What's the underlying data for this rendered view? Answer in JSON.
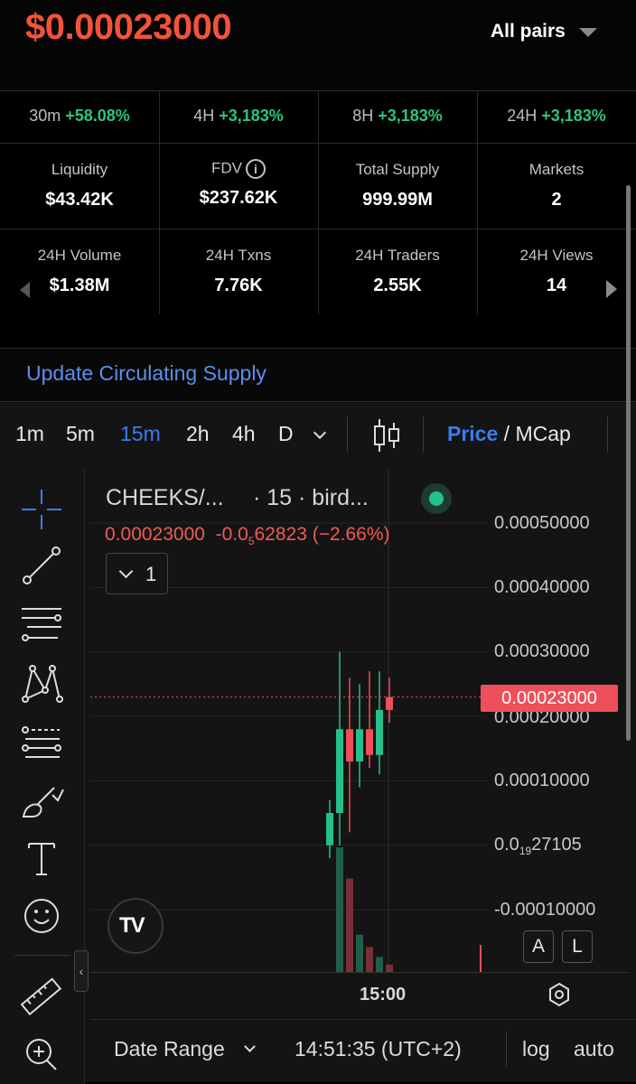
{
  "header": {
    "price": "$0.00023000",
    "pairs_label": "All pairs"
  },
  "changes": [
    {
      "period": "30m",
      "value": "+58.08%"
    },
    {
      "period": "4H",
      "value": "+3,183%"
    },
    {
      "period": "8H",
      "value": "+3,183%"
    },
    {
      "period": "24H",
      "value": "+3,183%"
    }
  ],
  "stats_row1": [
    {
      "label": "Liquidity",
      "value": "$43.42K"
    },
    {
      "label": "FDV",
      "value": "$237.62K",
      "icon": "info-icon",
      "icon_glyph": "i"
    },
    {
      "label": "Total Supply",
      "value": "999.99M"
    },
    {
      "label": "Markets",
      "value": "2"
    }
  ],
  "stats_row2": [
    {
      "label": "24H Volume",
      "value": "$1.38M"
    },
    {
      "label": "24H Txns",
      "value": "7.76K"
    },
    {
      "label": "24H Traders",
      "value": "2.55K"
    },
    {
      "label": "24H Views",
      "value": "14"
    }
  ],
  "update_link": "Update Circulating Supply",
  "timeframes": [
    "1m",
    "5m",
    "15m",
    "2h",
    "4h",
    "D"
  ],
  "active_timeframe": "15m",
  "price_mode": {
    "active": "Price",
    "separator": "/",
    "other": "MCap"
  },
  "chart": {
    "symbol": "CHEEKS/...",
    "symbol_rest": "· 15 · bird...",
    "ohlc_price": "0.00023000",
    "ohlc_change_pre": "-0.0",
    "ohlc_change_sub": "5",
    "ohlc_change_post": "62823 (−2.66%)",
    "indicator_count": "1",
    "last_price_tag": "0.00023000",
    "axis_labels": {
      "l1": "0.00050000",
      "l2": "0.00040000",
      "l3": "0.00030000",
      "l4": "0.00020000",
      "l5": "0.00010000",
      "l6_pre": "0.0",
      "l6_sub": "19",
      "l6_post": "27105",
      "l7": "-0.00010000"
    },
    "time_label": "15:00",
    "scale_buttons": [
      "A",
      "L"
    ],
    "logo_text": "TV"
  },
  "chart_data": {
    "type": "candlestick",
    "symbol": "CHEEKS/...",
    "interval": "15",
    "ylim": [
      -0.0001,
      0.0005
    ],
    "x_tick": "15:00",
    "candles": [
      {
        "open": 0.0,
        "high": 7e-05,
        "low": -2e-05,
        "close": 5e-05,
        "color": "up"
      },
      {
        "open": 5e-05,
        "high": 0.0003,
        "low": 0.0,
        "close": 0.00018,
        "color": "up"
      },
      {
        "open": 0.00018,
        "high": 0.00026,
        "low": 2e-05,
        "close": 0.00013,
        "color": "down"
      },
      {
        "open": 0.00013,
        "high": 0.00025,
        "low": 9e-05,
        "close": 0.00018,
        "color": "up"
      },
      {
        "open": 0.00018,
        "high": 0.00027,
        "low": 0.00012,
        "close": 0.00014,
        "color": "down"
      },
      {
        "open": 0.00014,
        "high": 0.00027,
        "low": 0.00011,
        "close": 0.00021,
        "color": "up"
      },
      {
        "open": 0.00021,
        "high": 0.00026,
        "low": 0.00019,
        "close": 0.00023,
        "color": "down"
      }
    ],
    "volume": [
      0.0,
      1.0,
      0.75,
      0.3,
      0.2,
      0.12,
      0.06
    ],
    "last_price": 0.00023
  },
  "bottom_bar": {
    "date_range": "Date Range",
    "time": "14:51:35 (UTC+2)",
    "log": "log",
    "auto": "auto"
  },
  "colors": {
    "price_red": "#f4523b",
    "green": "#2dc47a",
    "blue_link": "#5b8ff0",
    "active_blue": "#3d7bf0",
    "candle_up": "#26c08a",
    "candle_down": "#ef4f5a"
  },
  "tool_icons": [
    "crosshair-icon",
    "trend-line-icon",
    "fib-retracement-icon",
    "pattern-icon",
    "projection-icon",
    "brush-icon",
    "text-icon",
    "emoji-icon",
    "ruler-icon",
    "zoom-in-icon"
  ]
}
